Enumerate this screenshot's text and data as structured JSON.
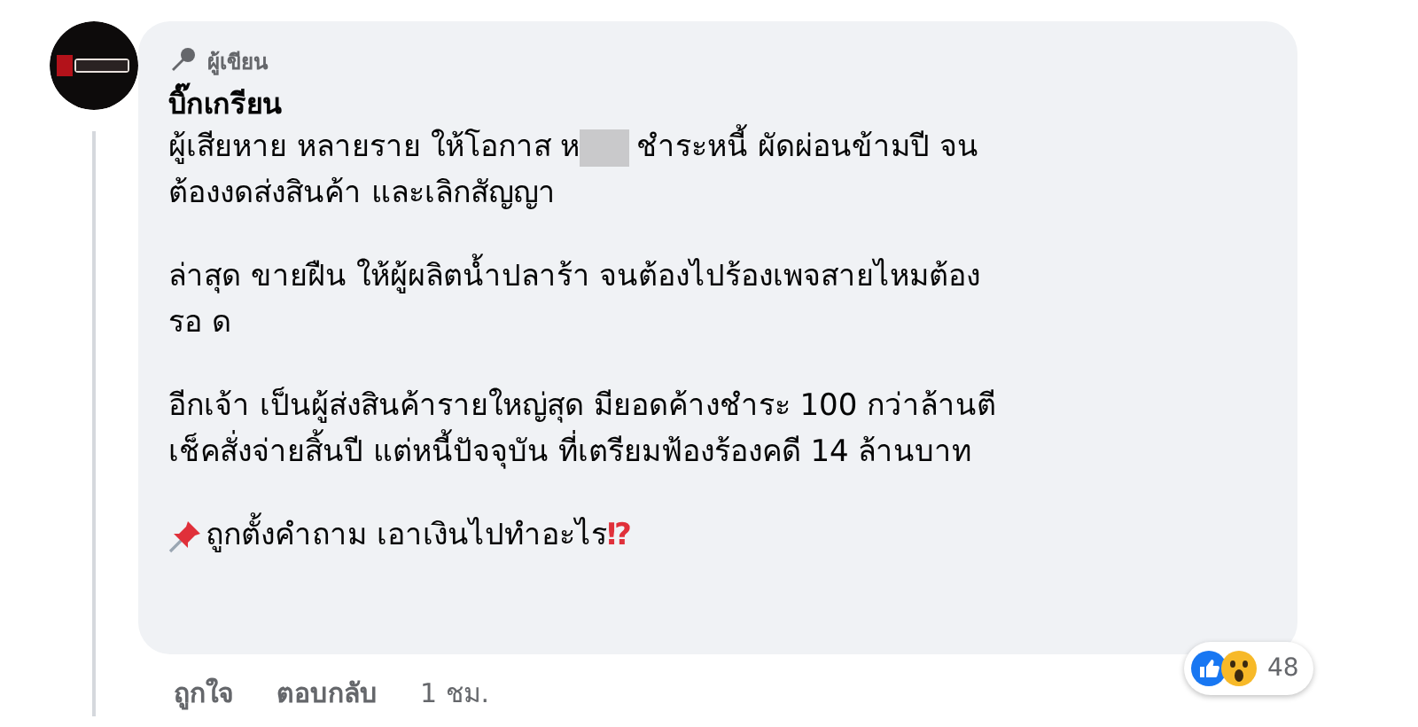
{
  "comment": {
    "badge": "ผู้เขียน",
    "author": "บิ๊กเกรียน",
    "paragraphs": [
      [
        [
          {
            "kind": "text",
            "text": "ผู้เสียหาย หลายราย ให้โอกาส ห"
          },
          {
            "kind": "redacted"
          },
          {
            "kind": "text",
            "text": " ชำระหนี้ ผัดผ่อนข้ามปี จน"
          }
        ],
        [
          {
            "kind": "text",
            "text": "ต้องงดส่งสินค้า และเลิกสัญญา"
          }
        ]
      ],
      [
        [
          {
            "kind": "text",
            "text": "ล่าสุด ขายฝืน ให้ผู้ผลิตน้ำปลาร้า จนต้องไปร้องเพจสายไหมต้อง"
          }
        ],
        [
          {
            "kind": "text",
            "text": "รอ ด"
          }
        ]
      ],
      [
        [
          {
            "kind": "text",
            "text": "อีกเจ้า เป็นผู้ส่งสินค้ารายใหญ่สุด มียอดค้างชำระ 100 กว่าล้านตี"
          }
        ],
        [
          {
            "kind": "text",
            "text": "เช็คสั่งจ่ายสิ้นปี แต่หนี้ปัจจุบัน ที่เตรียมฟ้องร้องคดี 14 ล้านบาท"
          }
        ]
      ],
      [
        [
          {
            "kind": "pin"
          },
          {
            "kind": "text",
            "text": "ถูกตั้งคำถาม เอาเงินไปทำอะไร"
          },
          {
            "kind": "emoji",
            "text": "⁉"
          }
        ]
      ]
    ],
    "reactions": {
      "count": "48"
    },
    "actions": [
      "ถูกใจ",
      "ตอบกลับ",
      "1 ชม."
    ]
  }
}
